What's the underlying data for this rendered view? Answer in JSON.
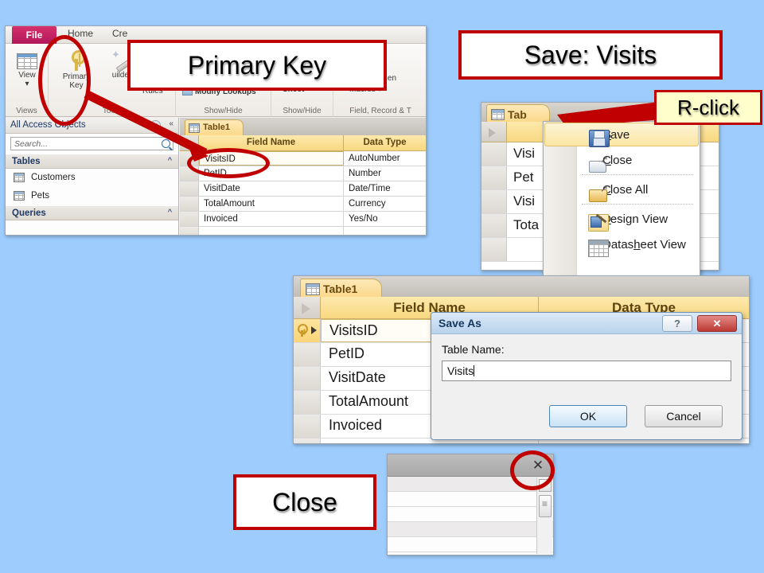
{
  "background_color": "#9dccfd",
  "accent_color": "#c00000",
  "main_window": {
    "ribbon": {
      "tabs": [
        {
          "label": "File",
          "name": "tab-file"
        },
        {
          "label": "Home",
          "name": "tab-home"
        },
        {
          "label": "Cre",
          "name": "tab-create"
        }
      ],
      "buttons": [
        {
          "label": "View",
          "sub": "▾",
          "icon": "datasheet-icon"
        },
        {
          "label": "Primary\nKey",
          "line1": "Primary",
          "line2": "Key",
          "icon": "key-icon"
        },
        {
          "label": "uilder",
          "icon": "builder-wand-icon"
        }
      ],
      "groups": [
        {
          "label": "Views"
        },
        {
          "label": "Tools"
        },
        {
          "label": "Show/Hide"
        },
        {
          "label": "Field, Record & T"
        }
      ],
      "items": [
        {
          "label": "Rules"
        },
        {
          "label": "Modify Lookups"
        },
        {
          "label": "Sheet"
        },
        {
          "label": "Macros ▾"
        },
        {
          "label": "ata  Ren"
        }
      ]
    },
    "nav_pane": {
      "title": "All Access Objects",
      "search_placeholder": "Search...",
      "groups": [
        {
          "label": "Tables",
          "items": [
            {
              "label": "Customers"
            },
            {
              "label": "Pets"
            }
          ]
        },
        {
          "label": "Queries",
          "items": []
        }
      ]
    },
    "document": {
      "tab_label": "Table1",
      "columns": [
        "Field Name",
        "Data Type"
      ],
      "rows": [
        {
          "field": "VisitsID",
          "type": "AutoNumber",
          "editing": true
        },
        {
          "field": "PetID",
          "type": "Number"
        },
        {
          "field": "VisitDate",
          "type": "Date/Time"
        },
        {
          "field": "TotalAmount",
          "type": "Currency"
        },
        {
          "field": "Invoiced",
          "type": "Yes/No"
        }
      ]
    }
  },
  "right_window": {
    "tab_label": "Tab",
    "rows": [
      "Visi",
      "Pet",
      "Visi",
      "Tota"
    ],
    "context_menu": {
      "items": [
        {
          "label": "Save",
          "accel": "S",
          "icon": "floppy-save-icon",
          "highlighted": true
        },
        {
          "label": "Close",
          "accel": "C",
          "icon": "close-window-icon",
          "highlighted": false
        },
        {
          "label": "Close All",
          "accel": "C",
          "icon": "close-all-folder-icon",
          "highlighted": false
        },
        {
          "label": "Design View",
          "accel": "D",
          "icon": "design-view-icon",
          "highlighted": false
        },
        {
          "label": "Datasheet View",
          "accel": "h",
          "icon": "datasheet-view-icon",
          "highlighted": false
        }
      ]
    }
  },
  "mid_window": {
    "tab_label": "Table1",
    "columns": [
      "Field Name",
      "Data Type"
    ],
    "rows": [
      {
        "field": "VisitsID",
        "primary_key": true
      },
      {
        "field": "PetID"
      },
      {
        "field": "VisitDate"
      },
      {
        "field": "TotalAmount"
      },
      {
        "field": "Invoiced"
      }
    ]
  },
  "save_as_dialog": {
    "title": "Save As",
    "help_label": "?",
    "close_label": "✕",
    "field_label": "Table Name:",
    "field_value": "Visits",
    "ok_label": "OK",
    "cancel_label": "Cancel"
  },
  "close_window": {
    "close_label": "✕"
  },
  "callouts": [
    {
      "id": "callout-pk",
      "text": "Primary Key"
    },
    {
      "id": "callout-save",
      "text": "Save: Visits"
    },
    {
      "id": "callout-rclick",
      "text": "R-click"
    },
    {
      "id": "callout-close",
      "text": "Close"
    }
  ],
  "annotations": {
    "primary_key_callout": "Primary Key",
    "save_callout": "Save: Visits",
    "rclick_callout": "R-click",
    "close_callout": "Close"
  }
}
